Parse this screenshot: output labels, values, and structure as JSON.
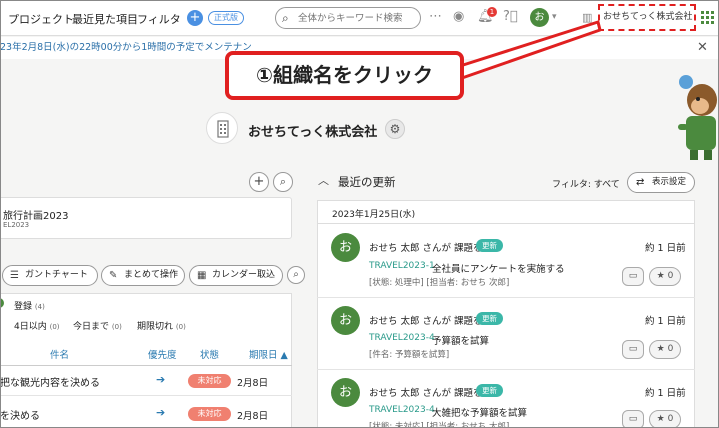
{
  "header": {
    "nav": [
      "プロジェクト",
      "最近見た項目",
      "フィルタ"
    ],
    "plan_badge": "正式版",
    "search_placeholder": "全体からキーワード検索",
    "notification_count": "1",
    "avatar_initial": "お",
    "org_name": "おせちてっく株式会社"
  },
  "banner": {
    "text": "23年2月8日(水)の22時00分から1時間の予定でメンテナン"
  },
  "callout": {
    "text": "①組織名をクリック"
  },
  "org": {
    "title": "おせちてっく株式会社"
  },
  "left": {
    "project": {
      "name": "旅行計画2023",
      "key": "EL2023"
    },
    "tools": [
      "ガントチャート",
      "まとめて操作",
      "カレンダー取込"
    ],
    "filters": {
      "registered": {
        "label": "登録",
        "count": "(4)"
      },
      "within4": {
        "label": "4日以内",
        "count": "(0)"
      },
      "today": {
        "label": "今日まで",
        "count": "(0)"
      },
      "overdue": {
        "label": "期限切れ",
        "count": "(0)"
      }
    },
    "columns": {
      "name": "件名",
      "priority": "優先度",
      "status": "状態",
      "due": "期限日 ▲"
    },
    "tasks": [
      {
        "name": "把な観光内容を決める",
        "status": "未対応",
        "due": "2月8日"
      },
      {
        "name": "を決める",
        "status": "未対応",
        "due": "2月8日"
      }
    ]
  },
  "right": {
    "heading": "最近の更新",
    "filter_label": "フィルタ: すべて",
    "settings_label": "表示設定",
    "date": "2023年1月25日(水)",
    "updates": [
      {
        "avatar": "お",
        "who": "おせち 太郎 さんが 課題を",
        "badge": "更新",
        "time": "約 1 日前",
        "key": "TRAVEL2023-1",
        "title": "全社員にアンケートを実施する",
        "meta": "[状態: 処理中] [担当者: おせち 次郎]",
        "stars": "0"
      },
      {
        "avatar": "お",
        "who": "おせち 太郎 さんが 課題を",
        "badge": "更新",
        "time": "約 1 日前",
        "key": "TRAVEL2023-4",
        "title": "予算額を試算",
        "meta": "[件名: 予算額を試算]",
        "stars": "0"
      },
      {
        "avatar": "お",
        "who": "おせち 太郎 さんが 課題を",
        "badge": "更新",
        "time": "約 1 日前",
        "key": "TRAVEL2023-4",
        "title": "大雑把な予算額を試算",
        "meta": "[状態: 未対応] [担当者: おせち 太郎]",
        "stars": "0"
      }
    ]
  },
  "colors": {
    "accent_green": "#4b8a3e",
    "highlight_red": "#e02020",
    "status_red": "#f08070",
    "update_teal": "#3bb7a8",
    "link_blue": "#2a7ab0"
  }
}
